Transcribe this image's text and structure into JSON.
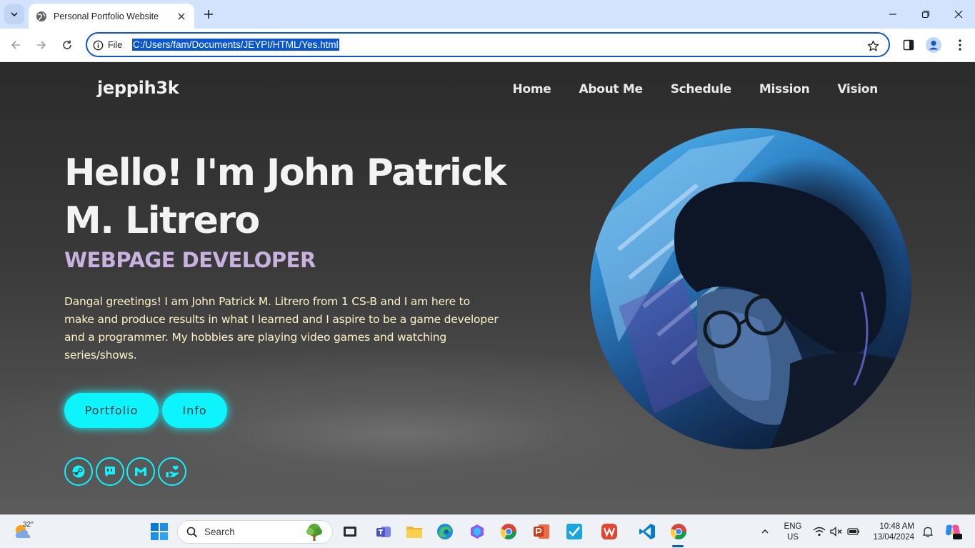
{
  "browser": {
    "tab_title": "Personal Portfolio Website",
    "site_info_label": "File",
    "url": "C:/Users/fam/Documents/JEYPI/HTML/Yes.html"
  },
  "site": {
    "logo": "jeppih3k",
    "nav": [
      "Home",
      "About Me",
      "Schedule",
      "Mission",
      "Vision"
    ],
    "hero": {
      "title": "Hello! I'm John Patrick M. Litrero",
      "role": "WEBPAGE DEVELOPER",
      "text": "Dangal greetings! I am John Patrick M. Litrero from 1 CS-B and I am here to make and produce results in what I learned and I aspire to be a game developer and a programmer. My hobbies are playing video games and watching series/shows.",
      "buttons": {
        "portfolio": "Portfolio",
        "info": "Info"
      }
    },
    "socials": [
      "steam-icon",
      "chat-icon",
      "gmail-icon",
      "support-icon"
    ],
    "accent_color": "#0ef4fd",
    "role_color": "#c9b1e0"
  },
  "taskbar": {
    "weather_temp": "32°",
    "search_label": "Search",
    "lang_top": "ENG",
    "lang_bottom": "US",
    "time": "10:48 AM",
    "date": "13/04/2024",
    "apps": [
      "task-view-icon",
      "teams-icon",
      "file-explorer-icon",
      "edge-icon",
      "copilot-icon",
      "chrome-icon",
      "powerpoint-icon",
      "todo-icon",
      "wps-icon",
      "vscode-icon",
      "chrome-active-icon"
    ]
  }
}
